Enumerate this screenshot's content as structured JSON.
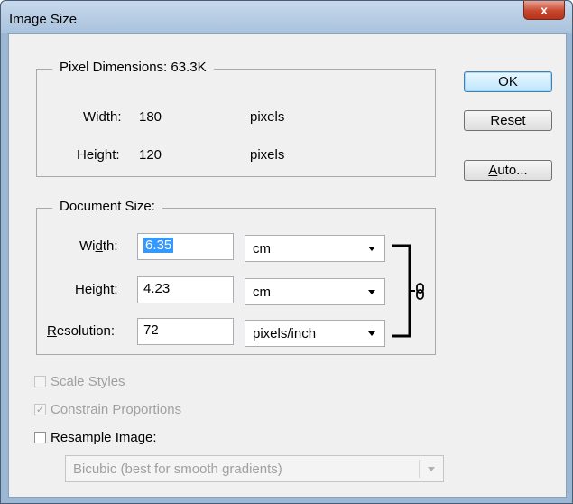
{
  "window": {
    "title": "Image Size",
    "close_glyph": "x"
  },
  "pixel_dimensions": {
    "title": "Pixel Dimensions:  63.3K",
    "width_label": "Width:",
    "width_value": "180",
    "width_unit": "pixels",
    "height_label": "Height:",
    "height_value": "120",
    "height_unit": "pixels"
  },
  "document_size": {
    "title": "Document Size:",
    "width_label_pre": "Wi",
    "width_label_ul": "d",
    "width_label_post": "th:",
    "width_value": "6.35",
    "width_unit": "cm",
    "height_label_pre": "Hei",
    "height_label_ul": "g",
    "height_label_post": "ht:",
    "height_value": "4.23",
    "height_unit": "cm",
    "resolution_label_ul": "R",
    "resolution_label_post": "esolution:",
    "resolution_value": "72",
    "resolution_unit": "pixels/inch",
    "link_icon": "chain-link-icon"
  },
  "buttons": {
    "ok": "OK",
    "reset": "Reset",
    "auto_ul": "A",
    "auto_post": "uto..."
  },
  "options": {
    "scale_styles_pre": "Scale St",
    "scale_styles_ul": "y",
    "scale_styles_post": "les",
    "scale_styles_checked": false,
    "constrain_ul": "C",
    "constrain_post": "onstrain Proportions",
    "constrain_checked": true,
    "resample_pre": "Resample ",
    "resample_ul": "I",
    "resample_post": "mage:",
    "resample_checked": false,
    "resample_method": "Bicubic (best for smooth gradients)"
  }
}
